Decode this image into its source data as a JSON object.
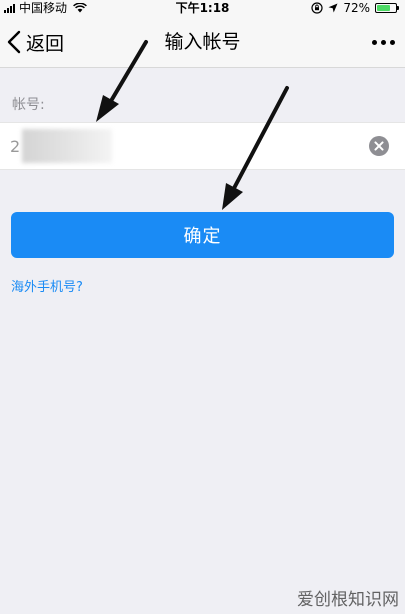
{
  "status_bar": {
    "carrier": "中国移动",
    "time": "下午1:18",
    "battery_percent_label": "72%",
    "battery_level": 0.72,
    "battery_color": "#4cd964"
  },
  "nav": {
    "back_label": "返回",
    "title": "输入帐号"
  },
  "form": {
    "account_label": "帐号:",
    "account_value": "2",
    "confirm_label": "确定",
    "overseas_link": "海外手机号?"
  },
  "colors": {
    "accent": "#1a8bf5",
    "background": "#efeff4"
  },
  "icons": [
    "signal-icon",
    "wifi-icon",
    "lock-rotation-icon",
    "location-icon",
    "battery-icon",
    "back-chevron-icon",
    "more-icon",
    "clear-icon"
  ],
  "watermark": "爱创根知识网"
}
